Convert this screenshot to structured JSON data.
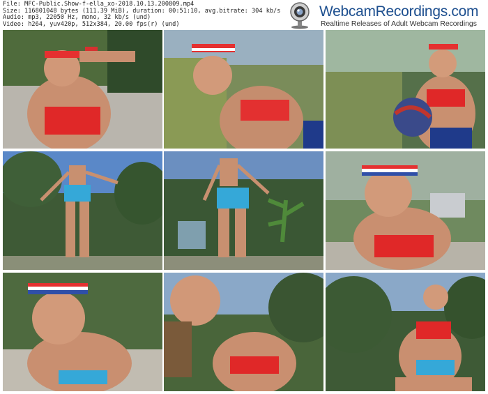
{
  "file_info": {
    "line1": "File: MFC-Public.Show-f-ella_xo-2018.10.13.200809.mp4",
    "line2": "Size: 116801048 bytes (111.39 MiB), duration: 00:51:10, avg.bitrate: 304 kb/s",
    "line3": "Audio: mp3, 22050 Hz, mono, 32 kb/s (und)",
    "line4": "Video: h264, yuv420p, 512x384, 20.00 fps(r) (und)"
  },
  "brand": {
    "name": "WebcamRecordings.com",
    "tagline": "Realtime Releases of Adult Webcam Recordings",
    "icon": "webcam-icon",
    "color": "#1d4f8f"
  },
  "thumbnails": [
    {
      "id": "thumb-1",
      "scene": "close-up, hand raised to headband, concrete background"
    },
    {
      "id": "thumb-2",
      "scene": "leaning toward camera, tall grass background"
    },
    {
      "id": "thumb-3",
      "scene": "holding basketball, shrubs background"
    },
    {
      "id": "thumb-4",
      "scene": "standing from behind, arms out, trees and sky"
    },
    {
      "id": "thumb-5",
      "scene": "standing from behind, banana plant and shed"
    },
    {
      "id": "thumb-6",
      "scene": "close-up face with headband, yard"
    },
    {
      "id": "thumb-7",
      "scene": "close-up crouching, headband"
    },
    {
      "id": "thumb-8",
      "scene": "close-up leaning, trees"
    },
    {
      "id": "thumb-9",
      "scene": "seated on ground, trees and sky"
    }
  ]
}
